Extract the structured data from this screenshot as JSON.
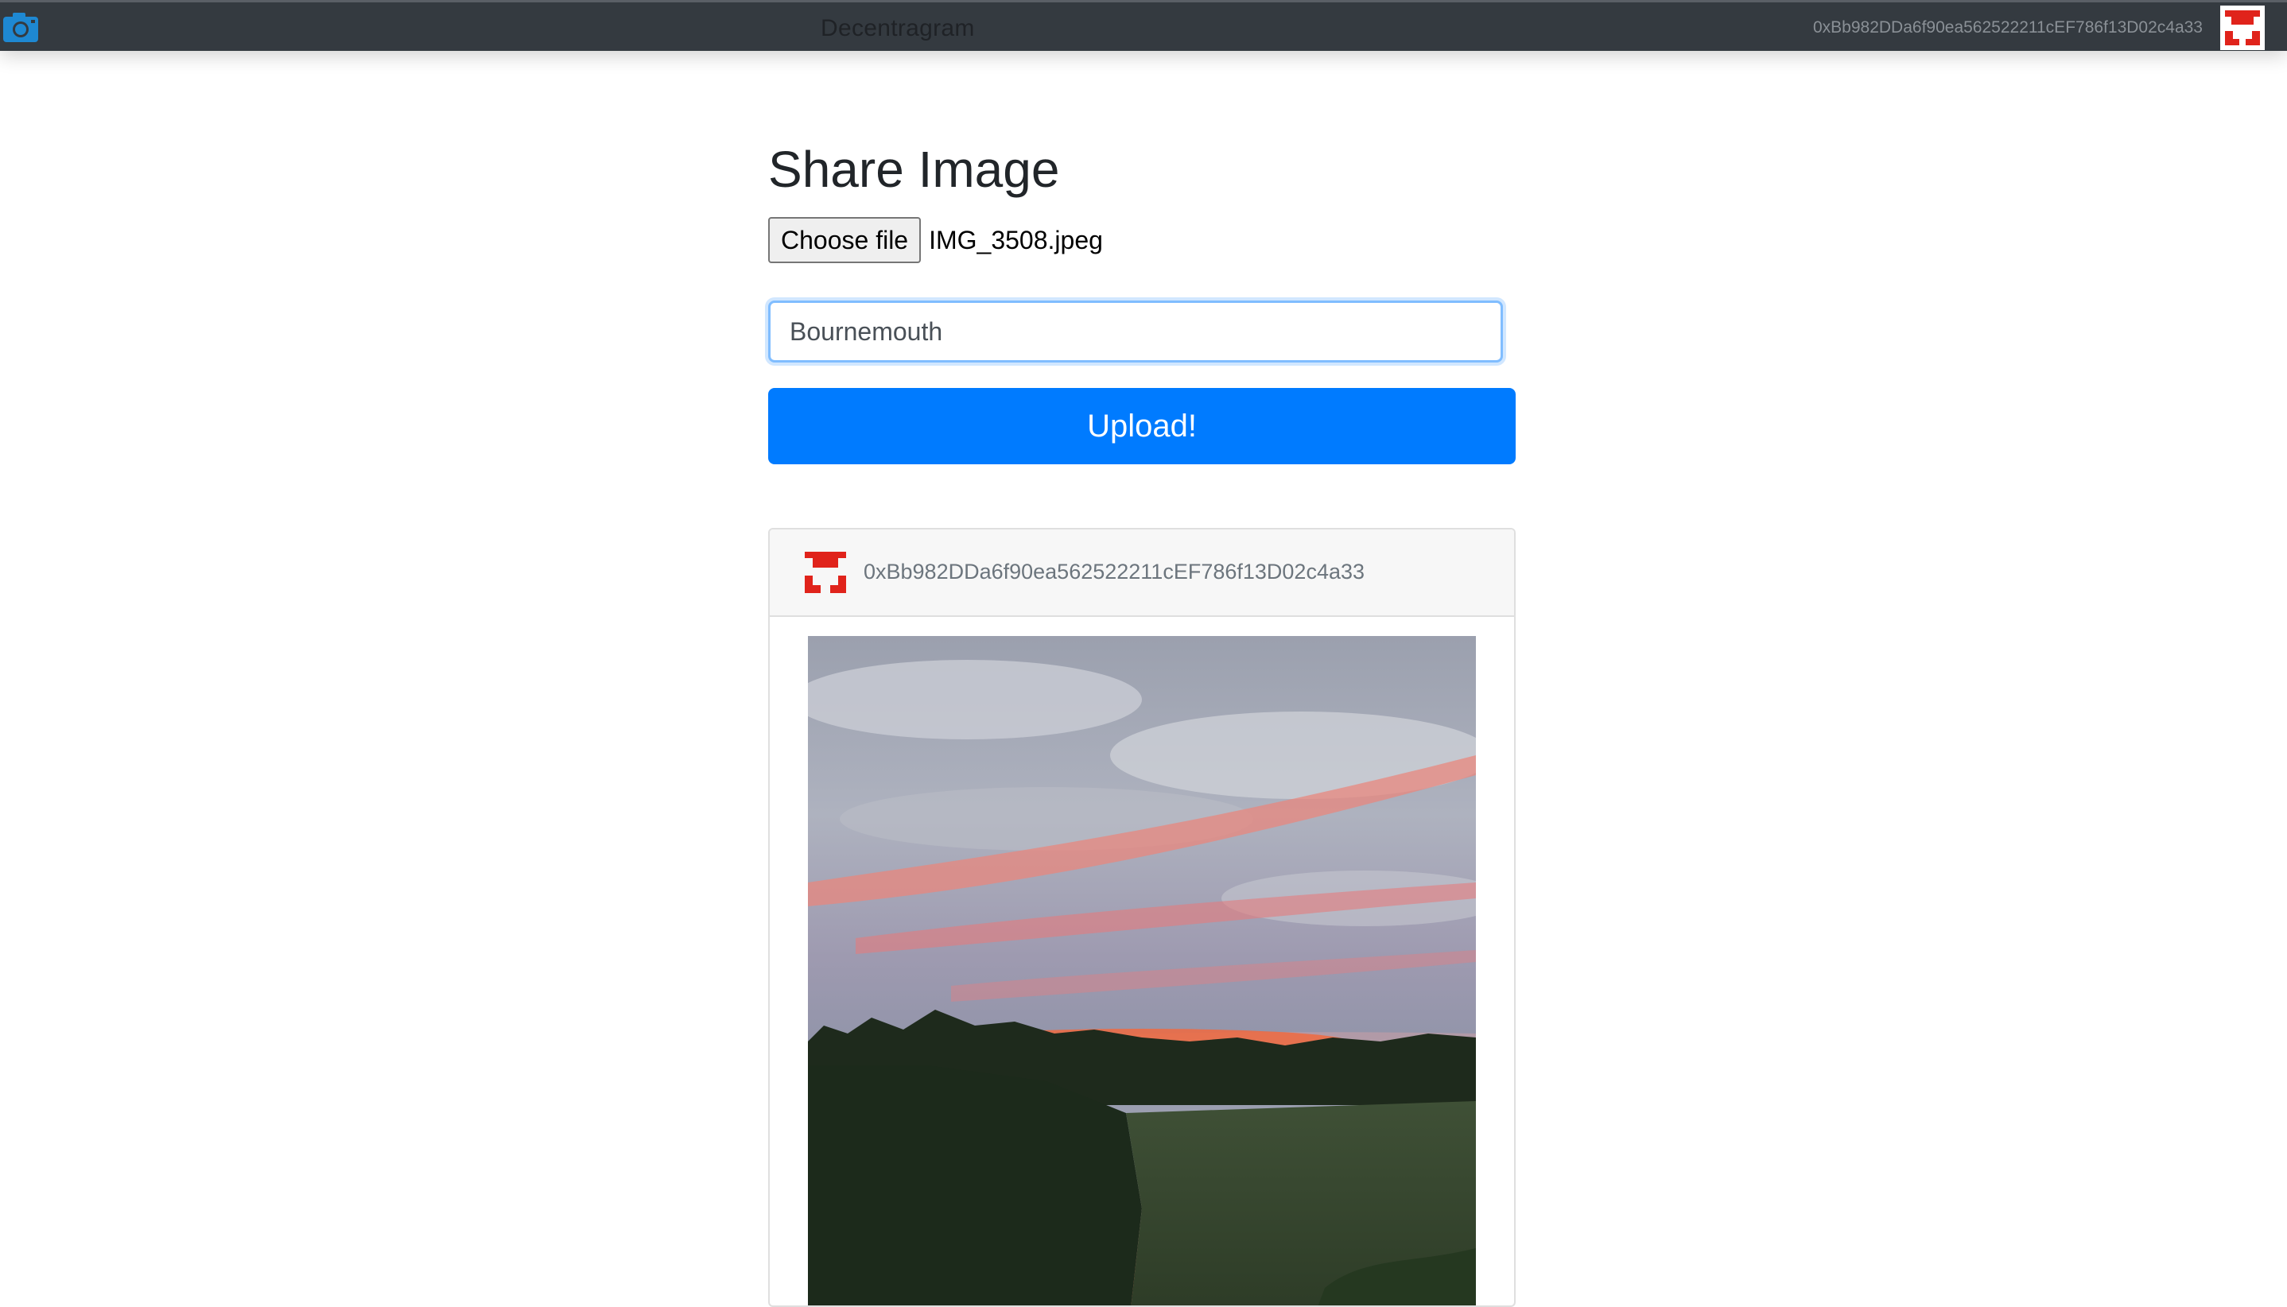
{
  "navbar": {
    "logo_icon": "camera-icon",
    "brand": "Decentragram",
    "account": "0xBb982DDa6f90ea562522211cEF786f13D02c4a33",
    "avatar_icon": "identicon-avatar"
  },
  "form": {
    "title": "Share Image",
    "file_button_label": "Choose file",
    "file_name": "IMG_3508.jpeg",
    "description_value": "Bournemouth",
    "upload_label": "Upload!"
  },
  "post": {
    "author": "0xBb982DDa6f90ea562522211cEF786f13D02c4a33",
    "avatar_icon": "identicon-avatar",
    "image": "sunset-landscape-photo"
  },
  "colors": {
    "navbar_bg": "#343a40",
    "primary": "#007bff",
    "identicon": "#e0231b",
    "focus_border": "#80bdff"
  }
}
